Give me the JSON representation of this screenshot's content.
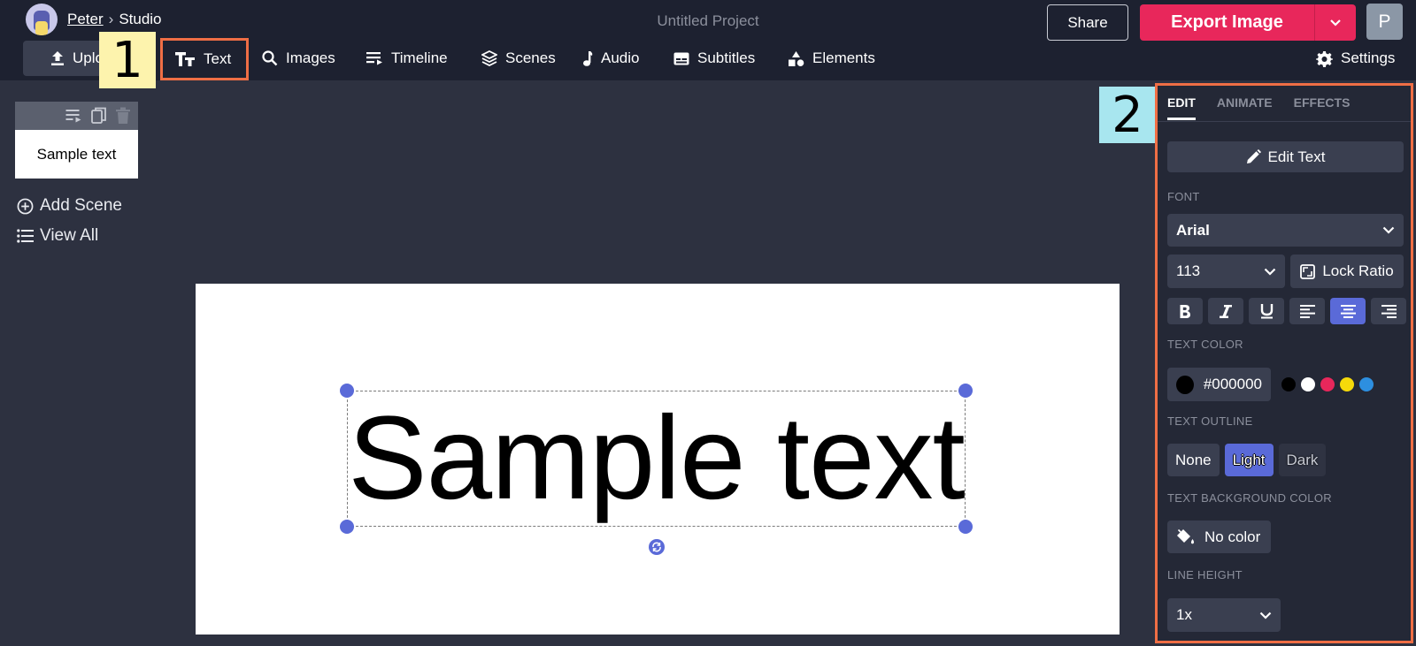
{
  "header": {
    "breadcrumb_user": "Peter",
    "breadcrumb_separator": "›",
    "breadcrumb_page": "Studio",
    "project_title": "Untitled Project",
    "share_label": "Share",
    "export_label": "Export Image",
    "user_initial": "P"
  },
  "toolbar": {
    "upload_label": "Uplo",
    "text_label": "Text",
    "images_label": "Images",
    "timeline_label": "Timeline",
    "scenes_label": "Scenes",
    "audio_label": "Audio",
    "subtitles_label": "Subtitles",
    "elements_label": "Elements",
    "settings_label": "Settings"
  },
  "markers": {
    "one": "1",
    "two": "2"
  },
  "sidebar": {
    "scene_preview_text": "Sample text",
    "add_scene_label": "Add Scene",
    "view_all_label": "View All"
  },
  "canvas": {
    "text": "Sample text"
  },
  "panel": {
    "tabs": [
      "EDIT",
      "ANIMATE",
      "EFFECTS"
    ],
    "edit_text_label": "Edit Text",
    "font_heading": "FONT",
    "font_value": "Arial",
    "font_size": "113",
    "lock_ratio_label": "Lock Ratio",
    "text_color_heading": "TEXT COLOR",
    "text_color_value": "#000000",
    "swatch_colors": [
      "#000000",
      "#ffffff",
      "#e8275b",
      "#f5d90a",
      "#2d8fe0"
    ],
    "text_outline_heading": "TEXT OUTLINE",
    "outline_options": [
      "None",
      "Light",
      "Dark"
    ],
    "outline_selected": "Light",
    "text_bg_heading": "TEXT BACKGROUND COLOR",
    "no_color_label": "No color",
    "line_height_heading": "LINE HEIGHT",
    "line_height_value": "1x"
  },
  "colors": {
    "accent": "#5a6ad8",
    "export": "#e8275b",
    "highlight": "#ef6e45"
  }
}
